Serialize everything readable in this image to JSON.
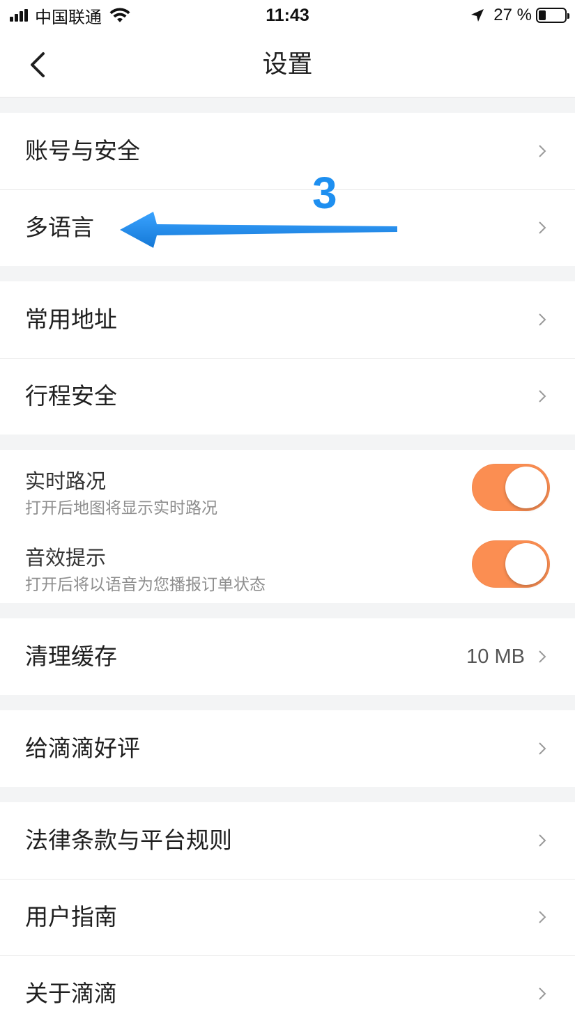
{
  "status_bar": {
    "carrier": "中国联通",
    "time": "11:43",
    "battery": "27 %",
    "battery_level": 0.27
  },
  "nav": {
    "title": "设置"
  },
  "sections": {
    "account": {
      "items": [
        {
          "label": "账号与安全"
        },
        {
          "label": "多语言"
        }
      ]
    },
    "address": {
      "items": [
        {
          "label": "常用地址"
        },
        {
          "label": "行程安全"
        }
      ]
    },
    "toggles": {
      "items": [
        {
          "title": "实时路况",
          "subtitle": "打开后地图将显示实时路况",
          "on": true
        },
        {
          "title": "音效提示",
          "subtitle": "打开后将以语音为您播报订单状态",
          "on": true
        }
      ]
    },
    "cache": {
      "label": "清理缓存",
      "value": "10 MB"
    },
    "rate": {
      "label": "给滴滴好评"
    },
    "about": {
      "items": [
        {
          "label": "法律条款与平台规则"
        },
        {
          "label": "用户指南"
        },
        {
          "label": "关于滴滴"
        }
      ]
    }
  },
  "annotation": {
    "number": "3",
    "color": "#1e8ff0"
  },
  "colors": {
    "toggle_on": "#fb8e52",
    "background": "#f3f4f5"
  }
}
